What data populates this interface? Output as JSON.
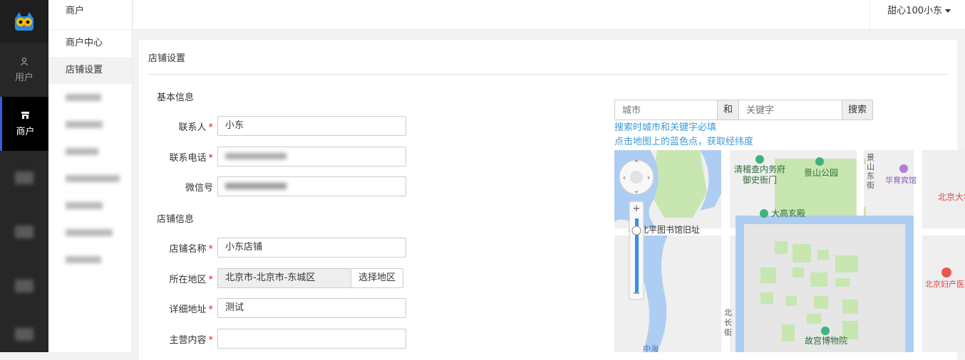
{
  "rail": {
    "items": [
      {
        "label": "用户",
        "icon": "user-icon"
      },
      {
        "label": "商户",
        "icon": "store-icon",
        "active": true
      }
    ]
  },
  "subnav": {
    "header": "商户",
    "items": [
      "商户中心",
      "店铺设置"
    ]
  },
  "topbar": {
    "user_label": "甜心100小东"
  },
  "page": {
    "title": "店铺设置",
    "basic_section": "基本信息",
    "shop_section": "店铺信息",
    "fields": {
      "contact": {
        "label": "联系人",
        "value": "小东"
      },
      "phone": {
        "label": "联系电话",
        "value": ""
      },
      "wechat": {
        "label": "微信号",
        "value": ""
      },
      "shop_name": {
        "label": "店铺名称",
        "value": "小东店铺"
      },
      "region": {
        "label": "所在地区",
        "value": "北京市-北京市-东城区",
        "button": "选择地区"
      },
      "address": {
        "label": "详细地址",
        "value": "测试"
      },
      "business": {
        "label": "主营内容",
        "value": ""
      }
    },
    "required_mark": "*"
  },
  "map_search": {
    "city_placeholder": "城市",
    "and_label": "和",
    "keyword_placeholder": "关键字",
    "search_button": "搜索",
    "hint1": "搜索时城市和关键字必填",
    "hint2": "点击地图上的蓝色点，获取经纬度"
  },
  "map": {
    "labels": {
      "qingjiao": "清稽查内务府",
      "yushi": "御史衙门",
      "jingshan": "景山公园",
      "jingshan_east": "景山东街",
      "huayu": "华育宾馆",
      "beijing_big": "北京大学",
      "dagao": "大高玄殿",
      "library": "北平图书馆旧址",
      "hospital": "北京妇产医院(西院)",
      "beichang": "北长街",
      "palace": "故宫博物院",
      "zhonghai": "中海"
    },
    "colors": {
      "water": "#aecdf2",
      "park": "#c8e6b0",
      "palace_bg": "#e6e6e6",
      "road": "#ffffff",
      "land": "#efefef"
    }
  }
}
